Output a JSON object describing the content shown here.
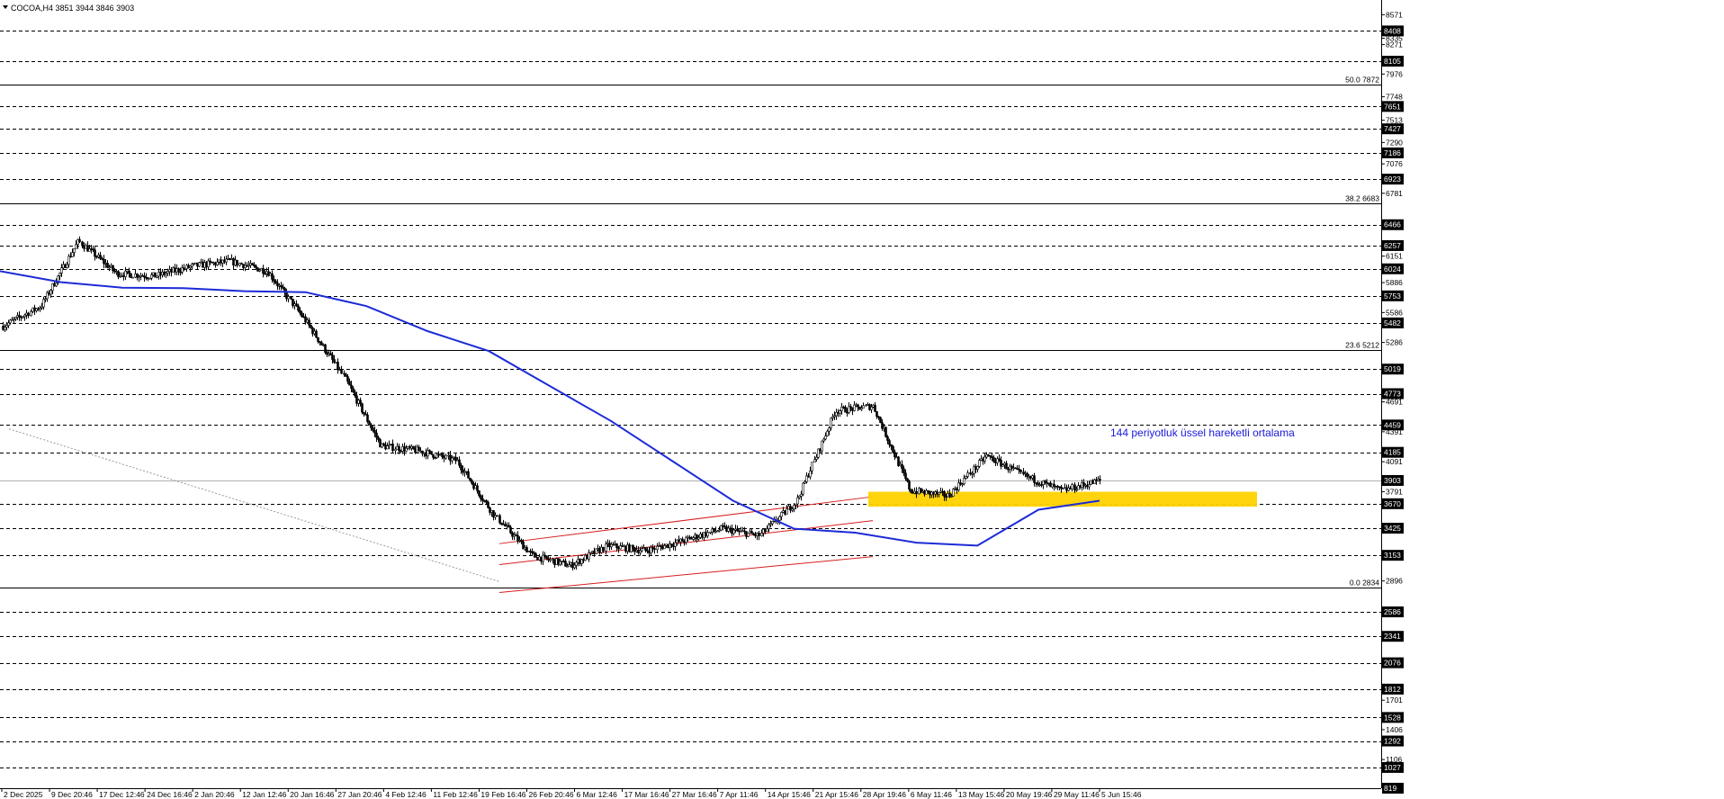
{
  "chart_data": {
    "type": "candlestick",
    "symbol_header": "COCOA,H4  3851 3944 3846 3903",
    "y_axis": {
      "range": [
        819,
        8700
      ],
      "tick_labels": [
        "8571",
        "8335",
        "8271",
        "8105",
        "7976",
        "7748",
        "7651",
        "7513",
        "7427",
        "7290",
        "7186",
        "7076",
        "6923",
        "6781",
        "6466",
        "6257",
        "6151",
        "6024",
        "5886",
        "5753",
        "5586",
        "5482",
        "5286",
        "5019",
        "4773",
        "4691",
        "4459",
        "4391",
        "4185",
        "4091",
        "3903",
        "3791",
        "3670",
        "3425",
        "3153",
        "2896",
        "2586",
        "2341",
        "2076",
        "1812",
        "1701",
        "1528",
        "1406",
        "1292",
        "1106",
        "1027",
        "819"
      ],
      "boxed_labels": [
        "8408",
        "8105",
        "7651",
        "7427",
        "7186",
        "6923",
        "6466",
        "6257",
        "6024",
        "5753",
        "5482",
        "5019",
        "4773",
        "4459",
        "4185",
        "3903",
        "3670",
        "3425",
        "3153",
        "2586",
        "2341",
        "2076",
        "1812",
        "1528",
        "1292",
        "1027",
        "819"
      ]
    },
    "x_axis": {
      "tick_labels": [
        "2 Dec 2025",
        "9 Dec 20:46",
        "17 Dec 12:46",
        "24 Dec 16:46",
        "2 Jan 20:46",
        "12 Jan 12:46",
        "20 Jan 16:46",
        "27 Jan 20:46",
        "4 Feb 12:46",
        "11 Feb 12:46",
        "19 Feb 16:46",
        "26 Feb 20:46",
        "6 Mar 12:46",
        "17 Mar 16:46",
        "27 Mar 16:46",
        "7 Apr 11:46",
        "14 Apr 15:46",
        "21 Apr 15:46",
        "28 Apr 19:46",
        "6 May 11:46",
        "13 May 15:46",
        "20 May 19:46",
        "29 May 11:46",
        "5 Jun 15:46"
      ]
    },
    "fibonacci_levels": [
      {
        "label": "50.0 7872",
        "value": 7872
      },
      {
        "label": "38.2 6683",
        "value": 6683
      },
      {
        "label": "23.6 5212",
        "value": 5212
      },
      {
        "label": "0.0 2834",
        "value": 2834
      }
    ],
    "current_price": 3903,
    "support_zone": {
      "low": 3640,
      "high": 3790,
      "color": "#ffd200"
    },
    "ema": {
      "label": "144 periyotluk üssel hareketli ortalama",
      "period": 144,
      "color": "#1c2bd6",
      "values": [
        6000,
        5890,
        5835,
        5830,
        5800,
        5790,
        5650,
        5400,
        5200,
        4850,
        4500,
        4100,
        3700,
        3420,
        3380,
        3280,
        3250,
        3610,
        3700
      ]
    },
    "price_path": [
      5450,
      5650,
      6300,
      5980,
      5950,
      6050,
      6100,
      6000,
      5500,
      4950,
      4250,
      4200,
      4100,
      3550,
      3150,
      3050,
      3250,
      3200,
      3300,
      3420,
      3350,
      3700,
      4600,
      4650,
      3800,
      3750,
      4150,
      3950,
      3800,
      3903
    ],
    "channel_color": "#d81e1e",
    "colors": {
      "candle": "#000000",
      "grid": "#000000",
      "zone": "#ffd200",
      "ema": "#1c2bd6",
      "channel": "#d81e1e"
    }
  }
}
